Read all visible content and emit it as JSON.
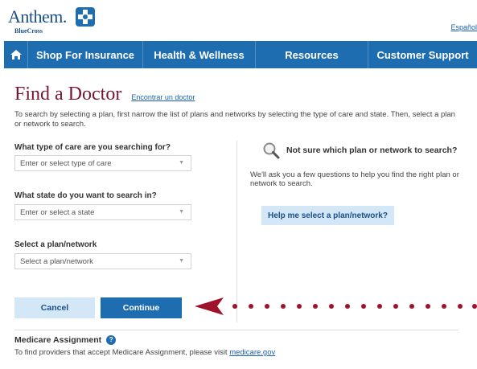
{
  "brand": {
    "logo_text": "Anthem.",
    "logo_sub": "BlueCross",
    "language_link": "Español"
  },
  "nav": {
    "items": [
      {
        "label": "Shop For Insurance"
      },
      {
        "label": "Health & Wellness"
      },
      {
        "label": "Resources"
      },
      {
        "label": "Customer Support"
      }
    ]
  },
  "page": {
    "title": "Find a Doctor",
    "title_link": "Encontrar un doctor",
    "intro": "To search by selecting a plan, first narrow the list of plans and networks by selecting the type of care and state. Then, select a plan or network to search."
  },
  "form": {
    "care_label": "What type of care are you searching for?",
    "care_placeholder": "Enter or select type of care",
    "state_label": "What state do you want to search in?",
    "state_placeholder": "Enter or select a state",
    "plan_label": "Select a plan/network",
    "plan_placeholder": "Select a plan/network",
    "cancel_label": "Cancel",
    "continue_label": "Continue"
  },
  "help": {
    "title": "Not sure which plan or network to search?",
    "text": "We'll ask you a few questions to help you find the right plan or network to search.",
    "button_label": "Help me select a plan/network?"
  },
  "medicare": {
    "title": "Medicare Assignment",
    "text": "To find providers that accept Medicare Assignment, please visit",
    "link": "medicare.gov"
  },
  "colors": {
    "brand_blue": "#1e6db0",
    "title_maroon": "#7a1631",
    "light_button": "#d4e7f7",
    "annotation_red": "#a0122c"
  },
  "icons": {
    "home": "home-icon",
    "search": "magnifier-icon",
    "help": "question-icon",
    "caret": "chevron-down-icon"
  }
}
